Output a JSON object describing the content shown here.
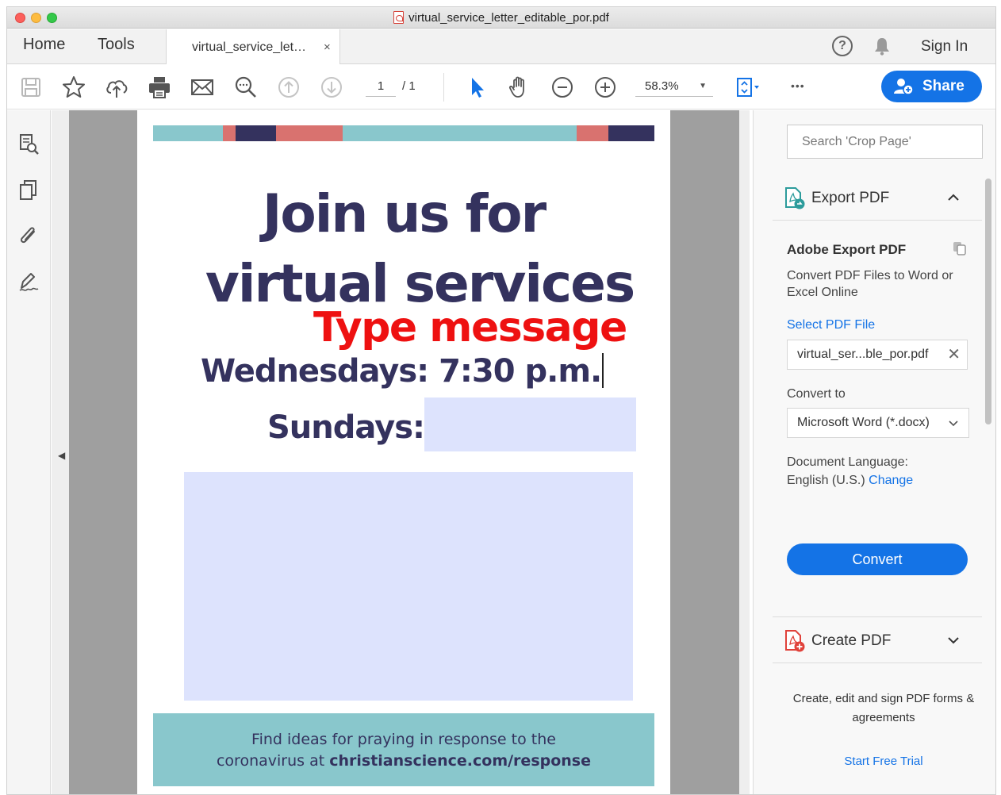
{
  "window": {
    "title": "virtual_service_letter_editable_por.pdf"
  },
  "tabs": {
    "home": "Home",
    "tools": "Tools",
    "document": "virtual_service_let…",
    "close": "×",
    "help": "?",
    "sign_in": "Sign In"
  },
  "toolbar": {
    "page_current": "1",
    "page_total": "/ 1",
    "zoom": "58.3%",
    "more": "•••",
    "share_label": "Share",
    "icons": [
      "save-icon",
      "star-icon",
      "cloud-upload-icon",
      "print-icon",
      "email-icon",
      "search-zoom-icon",
      "page-up-icon",
      "page-down-icon",
      "select-arrow-icon",
      "hand-icon",
      "zoom-out-icon",
      "zoom-in-icon",
      "fit-page-icon"
    ]
  },
  "left_rail": {
    "icons": [
      "page-thumbnails-icon",
      "copy-pages-icon",
      "attachment-icon",
      "signature-icon"
    ]
  },
  "document": {
    "headline_line1": "Join us for",
    "headline_line2": "virtual services",
    "type_message": "Type message",
    "wednesdays": "Wednesdays: 7:30 p.m.",
    "sundays": "Sundays:",
    "footer_line1": "Find ideas for praying in response to the",
    "footer_line2_prefix": "coronavirus at ",
    "footer_line2_link": "christianscience.com/response",
    "colors": {
      "navy": "#34325e",
      "teal": "#89c7cc",
      "coral": "#d9726f",
      "red_text": "#ee1111",
      "field_fill": "#dde3fd"
    }
  },
  "right_panel": {
    "search_placeholder": "Search 'Crop Page'",
    "export_pdf": {
      "header": "Export PDF",
      "title": "Adobe Export PDF",
      "description": "Convert PDF Files to Word or Excel Online",
      "select_file": "Select PDF File",
      "file_name": "virtual_ser...ble_por.pdf",
      "convert_to_label": "Convert to",
      "convert_to_value": "Microsoft Word (*.docx)",
      "doc_language_label": "Document Language:",
      "doc_language_value": "English (U.S.)",
      "change": "Change",
      "convert_button": "Convert"
    },
    "create_pdf": {
      "header": "Create PDF",
      "description": "Create, edit and sign PDF forms & agreements",
      "trial": "Start Free Trial"
    }
  }
}
